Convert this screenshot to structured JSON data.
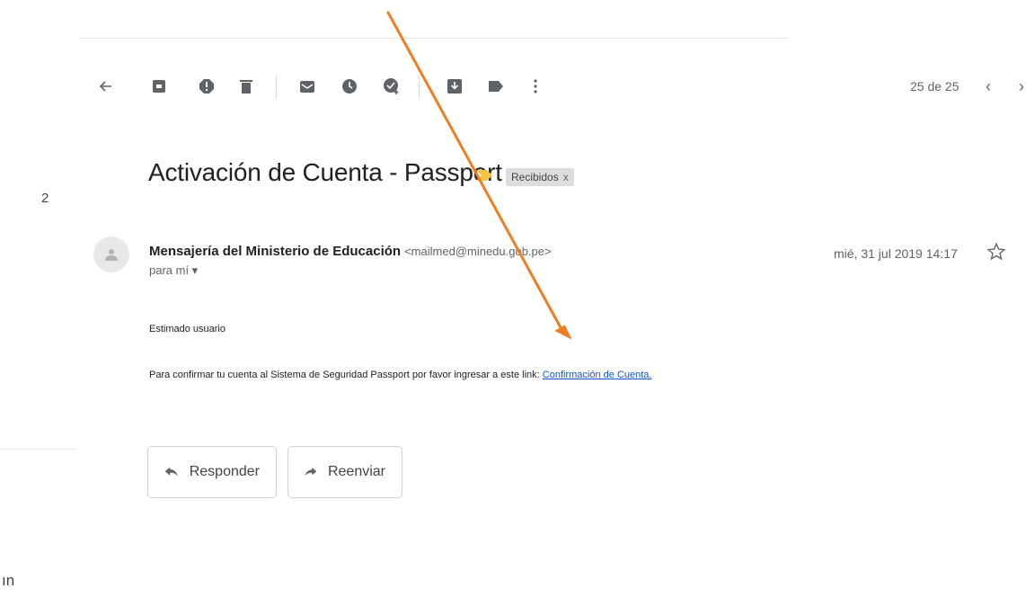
{
  "sidebar": {
    "count": "2",
    "fragment": "ın"
  },
  "toolbar": {
    "icons": [
      "back-arrow-icon",
      "archive-icon",
      "report-spam-icon",
      "delete-icon",
      "mark-unread-icon",
      "snooze-icon",
      "add-to-tasks-icon",
      "move-to-icon",
      "labels-icon",
      "more-icon"
    ]
  },
  "pager": {
    "text": "25 de 25"
  },
  "message": {
    "subject": "Activación de Cuenta - Passport",
    "label": "Recibidos",
    "label_remove": "x",
    "sender_name": "Mensajería del Ministerio de Educación",
    "sender_email": "<mailmed@minedu.gob.pe>",
    "to": "para mí ▾",
    "date": "mié, 31 jul 2019 14:17",
    "greeting": "Estimado usuario",
    "body_text": "Para confirmar tu cuenta al Sistema de Seguridad Passport por favor ingresar a este link:",
    "link_text": "Confirmación de Cuenta."
  },
  "actions": {
    "reply": "Responder",
    "forward": "Reenviar"
  },
  "colors": {
    "annotation_arrow": "#ef7d22",
    "link": "#1155cc",
    "important_marker": "#f5c342"
  }
}
